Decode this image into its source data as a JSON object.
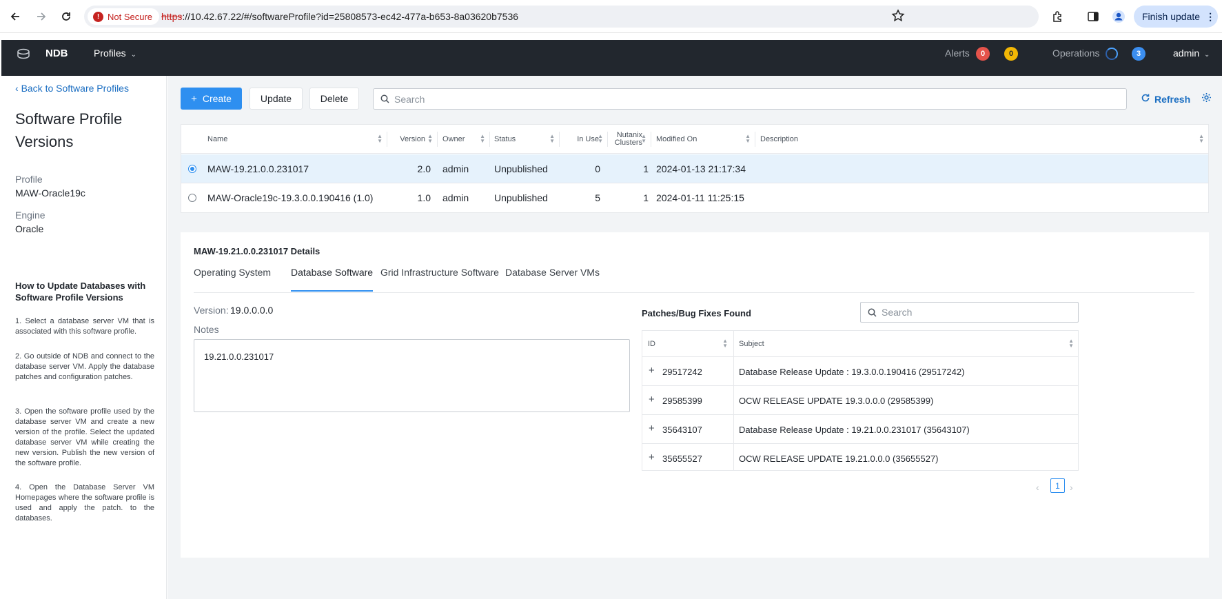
{
  "browser": {
    "security_label": "Not Secure",
    "url_scheme": "https",
    "url_rest": "://10.42.67.22/#/softwareProfile?id=25808573-ec42-477a-b653-8a03620b7536",
    "finish_update_label": "Finish update"
  },
  "header": {
    "app_name": "NDB",
    "profiles_menu": "Profiles",
    "alerts_label": "Alerts",
    "alerts_red_count": "0",
    "alerts_yellow_count": "0",
    "operations_label": "Operations",
    "operations_count": "3",
    "user": "admin",
    "colors": {
      "bar": "#22272e",
      "alert_red": "#e5534b",
      "alert_yellow": "#f2b705",
      "ops_blue": "#3b8ef0"
    }
  },
  "sidebar": {
    "back_link": "Back to Software Profiles",
    "title": "Software Profile Versions",
    "profile_label": "Profile",
    "profile_value": "MAW-Oracle19c",
    "engine_label": "Engine",
    "engine_value": "Oracle",
    "howto_title": "How to Update Databases with Software Profile Versions",
    "howto_steps": [
      "1. Select a database server VM that is associated with this software profile.",
      "2. Go outside of NDB and connect to the database server VM. Apply the database patches and configuration patches.",
      "3. Open the software profile used by the database server VM and create a new version of the profile. Select the updated database server VM while creating the new version. Publish the new version of the software profile.",
      "4. Open the Database Server VM Homepages where the software profile is used and apply the patch. to the databases."
    ]
  },
  "toolbar": {
    "create_label": "Create",
    "update_label": "Update",
    "delete_label": "Delete",
    "search_placeholder": "Search",
    "refresh_label": "Refresh"
  },
  "versions_table": {
    "columns": {
      "name": "Name",
      "version": "Version",
      "owner": "Owner",
      "status": "Status",
      "in_use": "In Use",
      "nutanix_line1": "Nutanix",
      "nutanix_line2": "Clusters",
      "modified_on": "Modified On",
      "description": "Description"
    },
    "rows": [
      {
        "selected": true,
        "name": "MAW-19.21.0.0.231017",
        "version": "2.0",
        "owner": "admin",
        "status": "Unpublished",
        "in_use": "0",
        "clusters": "1",
        "modified_on": "2024-01-13 21:17:34",
        "description": ""
      },
      {
        "selected": false,
        "name": "MAW-Oracle19c-19.3.0.0.190416 (1.0)",
        "version": "1.0",
        "owner": "admin",
        "status": "Unpublished",
        "in_use": "5",
        "clusters": "1",
        "modified_on": "2024-01-11 11:25:15",
        "description": ""
      }
    ]
  },
  "details": {
    "title": "MAW-19.21.0.0.231017 Details",
    "tabs": [
      "Operating System",
      "Database Software",
      "Grid Infrastructure Software",
      "Database Server VMs"
    ],
    "active_tab": "Database Software",
    "version_label": "Version:",
    "version_value": "19.0.0.0.0",
    "notes_label": "Notes",
    "notes_value": "19.21.0.0.231017",
    "patches_title": "Patches/Bug Fixes Found",
    "patch_search_placeholder": "Search",
    "patch_columns": {
      "id": "ID",
      "subject": "Subject"
    },
    "patches": [
      {
        "id": "29517242",
        "subject": "Database Release Update : 19.3.0.0.190416 (29517242)"
      },
      {
        "id": "29585399",
        "subject": "OCW RELEASE UPDATE 19.3.0.0.0 (29585399)"
      },
      {
        "id": "35643107",
        "subject": "Database Release Update : 19.21.0.0.231017 (35643107)"
      },
      {
        "id": "35655527",
        "subject": "OCW RELEASE UPDATE 19.21.0.0.0 (35655527)"
      }
    ],
    "pager_page": "1"
  }
}
